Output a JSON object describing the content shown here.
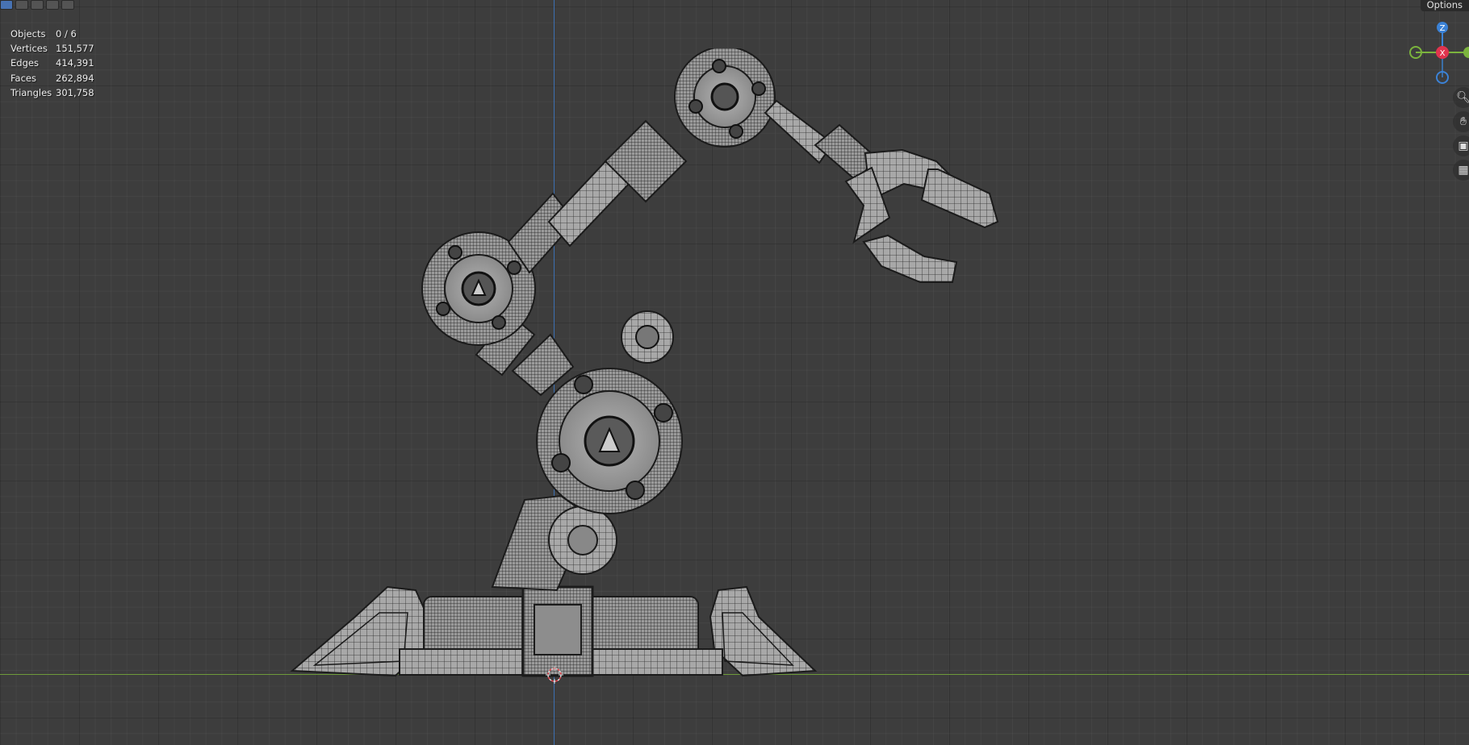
{
  "header": {
    "options_label": "Options",
    "mode_buttons": [
      "select-box",
      "select-extend",
      "select-subtract",
      "select-invert",
      "select-intersect"
    ]
  },
  "stats": [
    {
      "label": "Objects",
      "value": "0 / 6"
    },
    {
      "label": "Vertices",
      "value": "151,577"
    },
    {
      "label": "Edges",
      "value": "414,391"
    },
    {
      "label": "Faces",
      "value": "262,894"
    },
    {
      "label": "Triangles",
      "value": "301,758"
    }
  ],
  "gizmo": {
    "z_label": "Z",
    "x_label": "X",
    "z_color": "#3b82d6",
    "x_color": "#e0344e",
    "y_color": "#7bb33d"
  },
  "nav_tools": [
    "zoom-icon",
    "hand-pan-icon",
    "camera-icon",
    "grid-ortho-icon"
  ],
  "colors": {
    "background": "#3d3d3d",
    "z_axis": "#3c6fb2",
    "x_axis": "#6d9a3a",
    "mesh": "#a9a9a9",
    "wire": "#1b1b1b"
  }
}
